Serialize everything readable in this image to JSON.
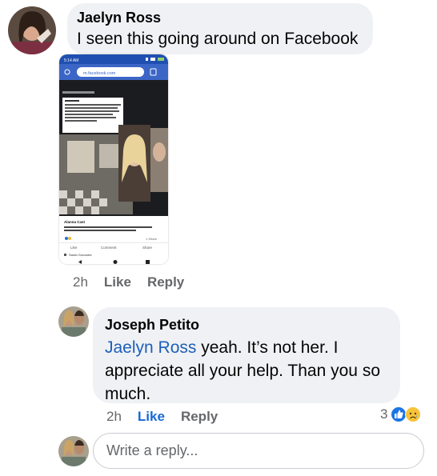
{
  "comment": {
    "author": "Jaelyn Ross",
    "text": "I seen this going around on Facebook",
    "time": "2h",
    "like_label": "Like",
    "reply_label": "Reply"
  },
  "attachment": {
    "status_time": "5:14 AM",
    "url": "m.facebook.com",
    "post_author": "Alanna Cast",
    "post_text": "Am I crazy or does this not look EXACTLY LIKE the girl who is missing??? This is so scary",
    "share_count": "1 Share",
    "like": "Like",
    "comment": "Comment",
    "share": "Share",
    "comment_author": "Sarah Gonzalez"
  },
  "reply": {
    "author": "Joseph Petito",
    "mention": "Jaelyn Ross",
    "text": " yeah. It’s not her. I appreciate all your help. Than you so much.",
    "time": "2h",
    "like_label": "Like",
    "reply_label": "Reply",
    "reaction_count": "3",
    "reactions": [
      "like",
      "sad"
    ]
  },
  "composer": {
    "placeholder": "Write a reply..."
  },
  "colors": {
    "bubble": "#eff1f4",
    "mention": "#1d5fb8",
    "liked": "#1769d6",
    "meta": "#65676b"
  }
}
